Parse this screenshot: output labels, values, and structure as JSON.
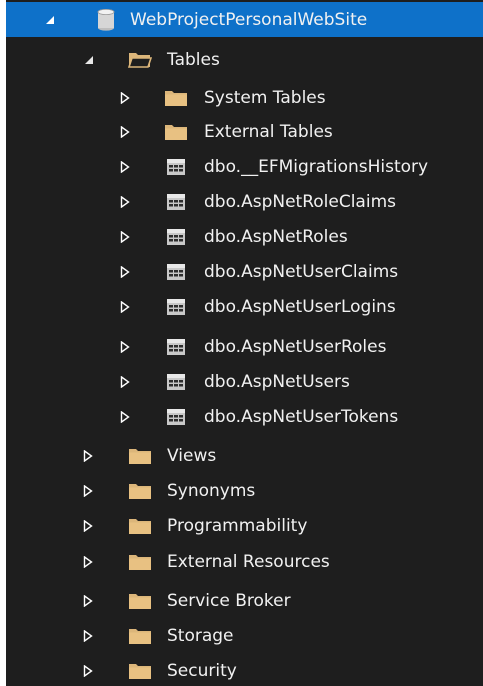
{
  "tree": {
    "root": {
      "label": "WebProjectPersonalWebSite",
      "expanded": true,
      "icon": "database-icon"
    },
    "tables": {
      "label": "Tables",
      "expanded": true,
      "icon": "open-folder-icon",
      "items": [
        {
          "label": "System Tables",
          "icon": "folder-icon"
        },
        {
          "label": "External Tables",
          "icon": "folder-icon"
        },
        {
          "label": "dbo.__EFMigrationsHistory",
          "icon": "table-icon"
        },
        {
          "label": "dbo.AspNetRoleClaims",
          "icon": "table-icon"
        },
        {
          "label": "dbo.AspNetRoles",
          "icon": "table-icon"
        },
        {
          "label": "dbo.AspNetUserClaims",
          "icon": "table-icon"
        },
        {
          "label": "dbo.AspNetUserLogins",
          "icon": "table-icon"
        },
        {
          "label": "dbo.AspNetUserRoles",
          "icon": "table-icon"
        },
        {
          "label": "dbo.AspNetUsers",
          "icon": "table-icon"
        },
        {
          "label": "dbo.AspNetUserTokens",
          "icon": "table-icon"
        }
      ]
    },
    "folders": [
      {
        "label": "Views",
        "icon": "folder-icon"
      },
      {
        "label": "Synonyms",
        "icon": "folder-icon"
      },
      {
        "label": "Programmability",
        "icon": "folder-icon"
      },
      {
        "label": "External Resources",
        "icon": "folder-icon"
      },
      {
        "label": "Service Broker",
        "icon": "folder-icon"
      },
      {
        "label": "Storage",
        "icon": "folder-icon"
      },
      {
        "label": "Security",
        "icon": "folder-icon"
      }
    ]
  },
  "colors": {
    "background": "#1e1e1e",
    "selection": "#0e71c9",
    "text": "#f1f1f1",
    "folder": "#dcb67a"
  }
}
